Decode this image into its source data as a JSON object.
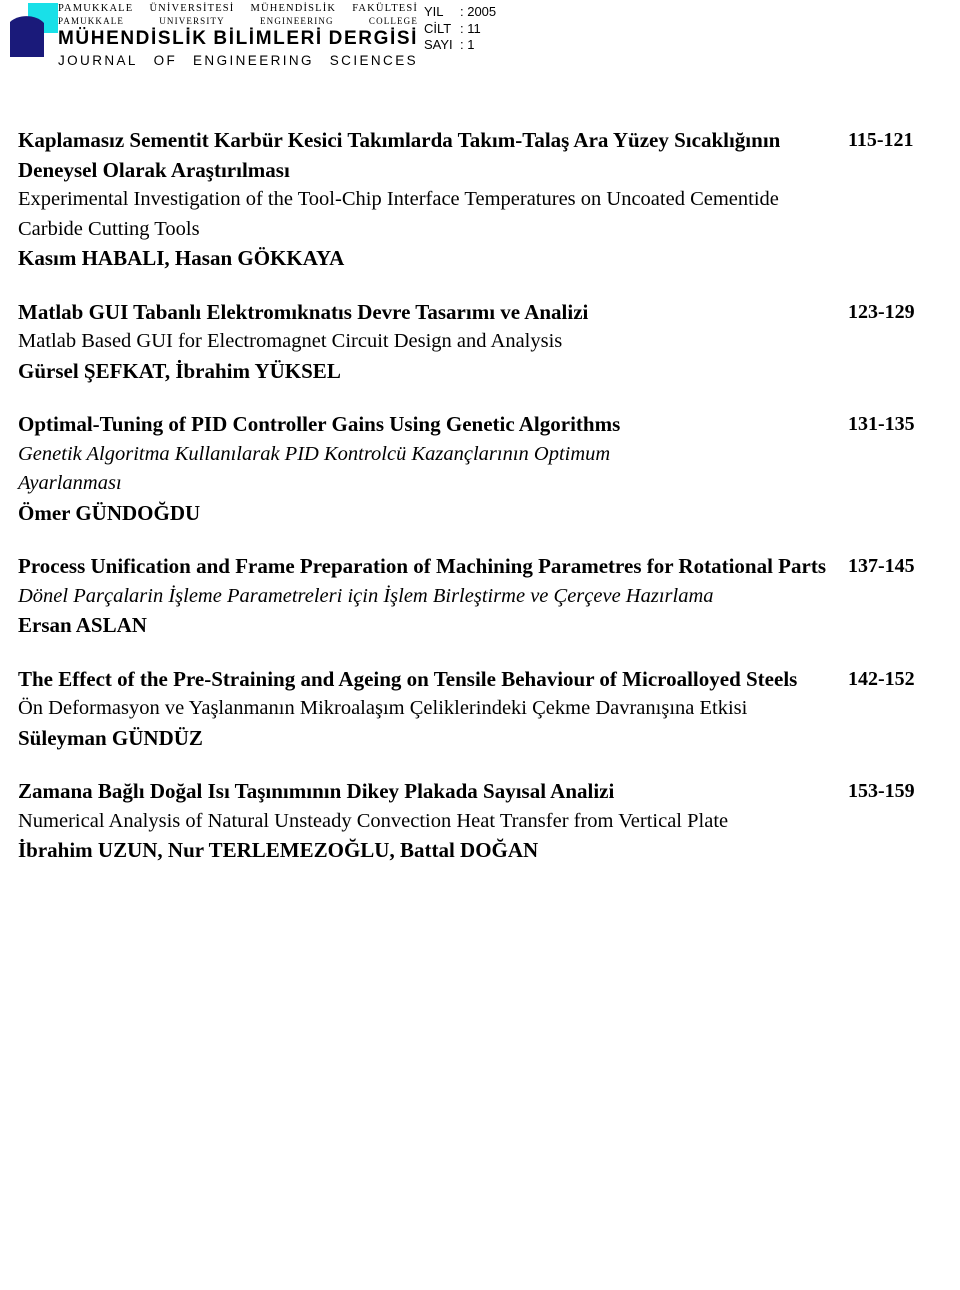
{
  "masthead": {
    "logo_colors": {
      "cyan": "#19E0E8",
      "navy": "#1A1A7A"
    },
    "university_tr": "PAMUKKALE ÜNİVERSİTESİ MÜHENDİSLİK FAKÜLTESİ",
    "university_tr_parts": [
      "PAMUKKALE",
      "ÜNİVERSİTESİ",
      "MÜHENDİSLİK",
      "FAKÜLTESİ"
    ],
    "university_en": "PAMUKKALE UNIVERSITY ENGINEERING COLLEGE",
    "university_en_parts": [
      "PAMUKKALE",
      "UNIVERSITY",
      "ENGINEERING",
      "COLLEGE"
    ],
    "journal_tr": "MÜHENDİSLİK BİLİMLERİ DERGİSİ",
    "journal_tr_parts": [
      "MÜHENDİSLİK",
      "BİLİMLERİ",
      "DERGİSİ"
    ],
    "journal_en": "JOURNAL OF ENGINEERING SCIENCES",
    "journal_en_parts": [
      "JOURNAL",
      "OF",
      "ENGINEERING",
      "SCIENCES"
    ],
    "issue": {
      "year_label": "YIL",
      "year_value": ": 2005",
      "volume_label": "CİLT",
      "volume_value": ": 11",
      "number_label": "SAYI",
      "number_value": ": 1"
    }
  },
  "entries": [
    {
      "title": "Kaplamasız Sementit Karbür Kesici Takımlarda Takım-Talaş Ara Yüzey Sıcaklığının Deneysel Olarak Araştırılması",
      "subtitle": "Experimental Investigation of the Tool-Chip Interface Temperatures on Uncoated Cementide Carbide Cutting Tools",
      "authors": "Kasım HABALI, Hasan GÖKKAYA",
      "pages": "115-121"
    },
    {
      "title": "Matlab GUI Tabanlı Elektromıknatıs Devre Tasarımı ve Analizi",
      "subtitle": "Matlab Based GUI  for Electromagnet Circuit Design and Analysis",
      "authors": "Gürsel ŞEFKAT, İbrahim YÜKSEL",
      "pages": "123-129"
    },
    {
      "title": "Optimal-Tuning of PID Controller Gains Using Genetic Algorithms",
      "subtitle": "Genetik Algoritma Kullanılarak PID Kontrolcü Kazançlarının Optimum Ayarlanması",
      "authors": "Ömer GÜNDOĞDU",
      "pages": "131-135"
    },
    {
      "title": "Process Unification and Frame Preparation of Machining Parametres for Rotational Parts",
      "subtitle": "Dönel Parçalarin İşleme Parametreleri için İşlem Birleştirme ve Çerçeve Hazırlama",
      "authors": "Ersan ASLAN",
      "pages": "137-145"
    },
    {
      "title": "The Effect of  the Pre-Straining and Ageing on Tensile Behaviour of Microalloyed Steels",
      "subtitle": "Ön Deformasyon ve Yaşlanmanın Mikroalaşım Çeliklerindeki Çekme Davranışına Etkisi",
      "authors": "Süleyman GÜNDÜZ",
      "pages": "142-152"
    },
    {
      "title": "Zamana Bağlı Doğal Isı Taşınımının Dikey Plakada Sayısal Analizi",
      "subtitle": "Numerical Analysis of Natural Unsteady Convection Heat Transfer from Vertical Plate",
      "authors": "İbrahim UZUN, Nur TERLEMEZOĞLU, Battal DOĞAN",
      "pages": "153-159"
    }
  ]
}
